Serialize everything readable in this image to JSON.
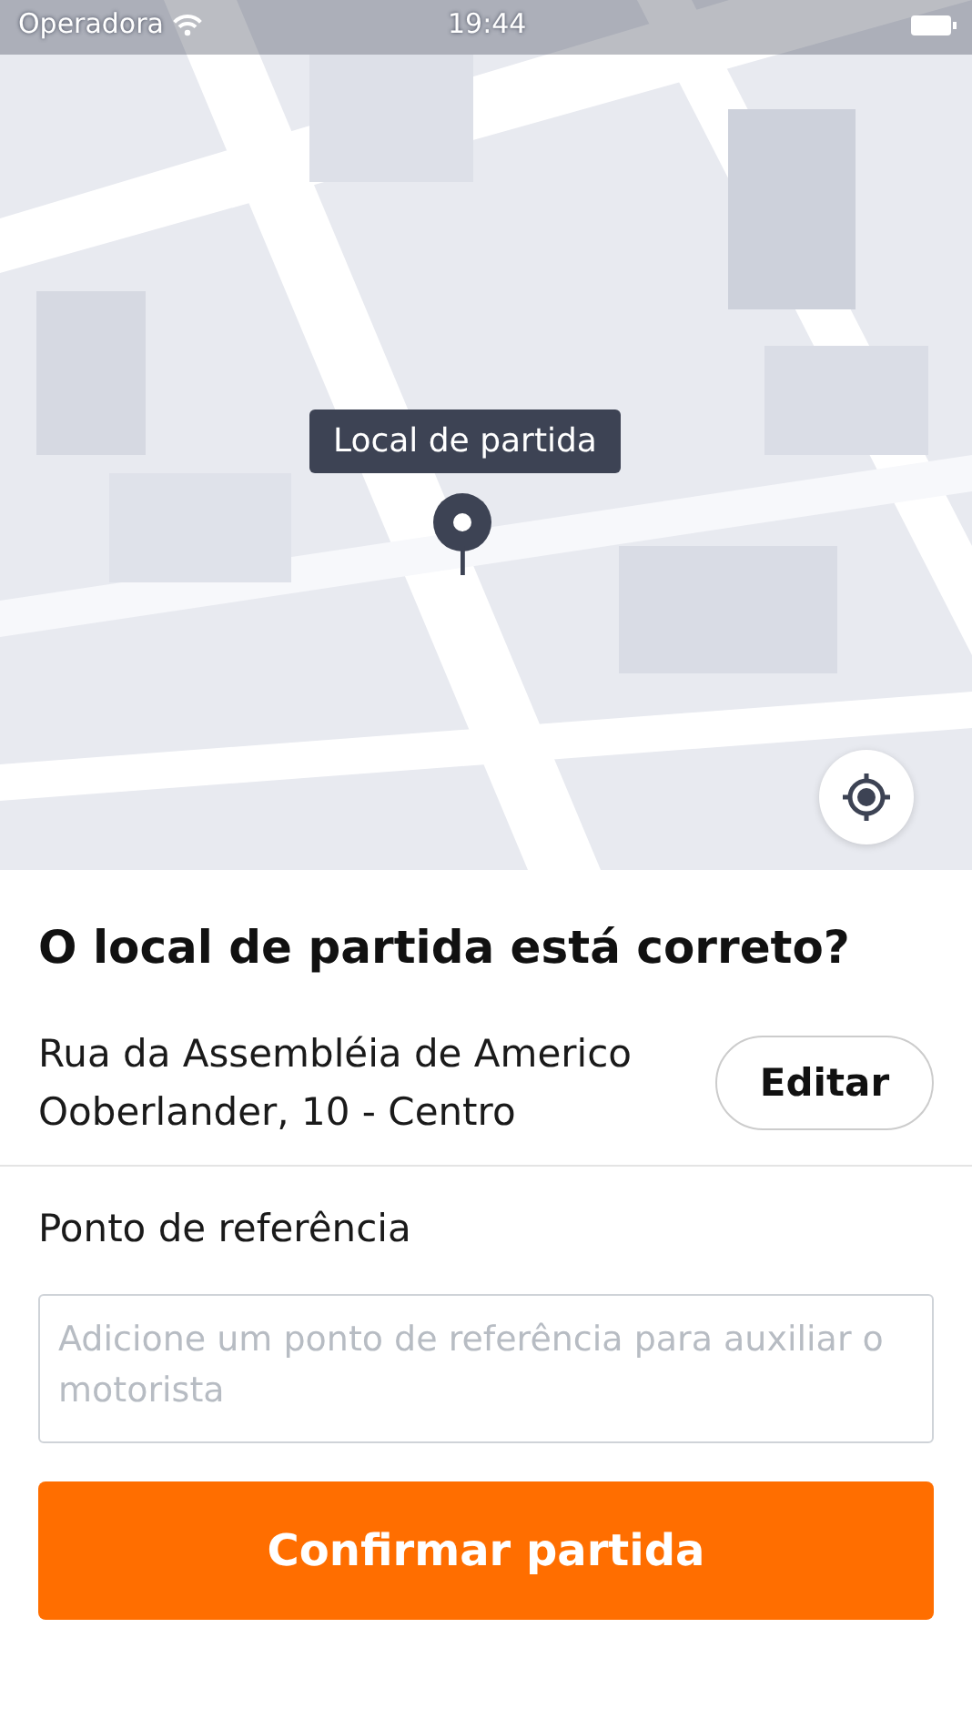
{
  "status_bar": {
    "carrier": "Operadora",
    "time": "19:44"
  },
  "map": {
    "kind": "picture",
    "pin_label": "Local de partida"
  },
  "title": "O local de partida está correto?",
  "address": {
    "text": "Rua da Assembléia de Americo Ooberlander, 10 - Centro",
    "edit_button": "Editar"
  },
  "reference": {
    "label": "Ponto de referência",
    "placeholder": "Adicione um ponto de referência para auxiliar o motorista"
  },
  "confirm_button": "Confirmar partida"
}
